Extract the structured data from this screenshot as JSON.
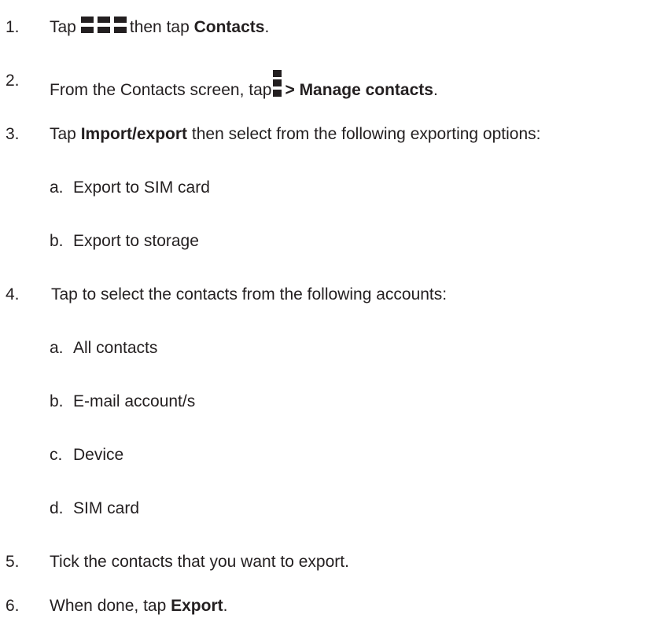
{
  "steps": [
    {
      "number": "1.",
      "pre": "Tap",
      "icon": "apps-grid-icon",
      "mid": "then tap",
      "bold": "Contacts",
      "post": "."
    },
    {
      "number": "2.",
      "pre": "From the Contacts screen, tap",
      "icon": "menu-icon",
      "bold": "> Manage contacts",
      "post": "."
    },
    {
      "number": "3.",
      "pre": "Tap",
      "bold": "Import/export",
      "post": "then select from the following exporting options:",
      "sub": [
        {
          "letter": "a.",
          "text": "Export to SIM card"
        },
        {
          "letter": "b.",
          "text": "Export to storage"
        }
      ]
    },
    {
      "number": "4.",
      "text": "Tap to select the contacts from the following accounts:",
      "sub": [
        {
          "letter": "a.",
          "text": "All contacts"
        },
        {
          "letter": "b.",
          "text": "E-mail account/s"
        },
        {
          "letter": "c.",
          "text": "Device"
        },
        {
          "letter": "d.",
          "text": "SIM card"
        }
      ]
    },
    {
      "number": "5.",
      "text": "Tick the contacts that you want to export."
    },
    {
      "number": "6.",
      "pre": "When done, tap",
      "bold": "Export",
      "post": "."
    }
  ],
  "text_color": "#231f20"
}
